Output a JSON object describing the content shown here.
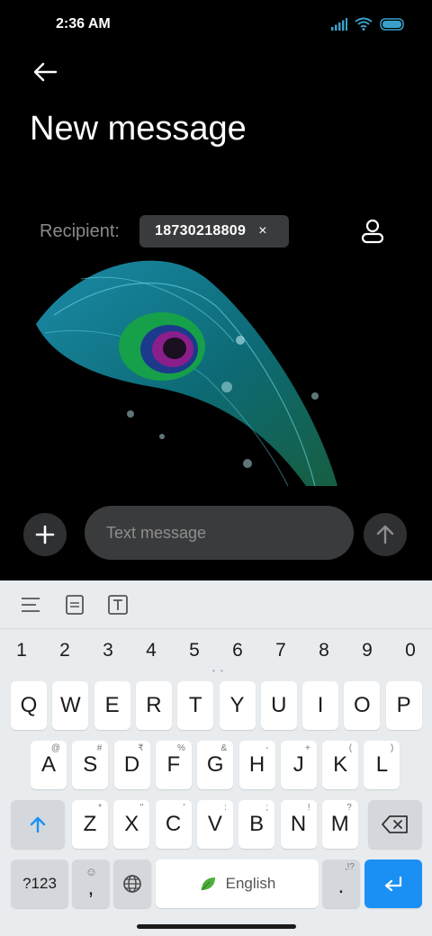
{
  "status_bar": {
    "time": "2:36 AM"
  },
  "header": {
    "title": "New message"
  },
  "recipient": {
    "label": "Recipient:",
    "chip_number": "18730218809",
    "chip_remove": "×"
  },
  "composer": {
    "placeholder": "Text message"
  },
  "keyboard": {
    "number_row": [
      "1",
      "2",
      "3",
      "4",
      "5",
      "6",
      "7",
      "8",
      "9",
      "0"
    ],
    "row1": [
      "Q",
      "W",
      "E",
      "R",
      "T",
      "Y",
      "U",
      "I",
      "O",
      "P"
    ],
    "row2": [
      {
        "key": "A",
        "hint": "@"
      },
      {
        "key": "S",
        "hint": "#"
      },
      {
        "key": "D",
        "hint": "₹"
      },
      {
        "key": "F",
        "hint": "%"
      },
      {
        "key": "G",
        "hint": "&"
      },
      {
        "key": "H",
        "hint": "-"
      },
      {
        "key": "J",
        "hint": "+"
      },
      {
        "key": "K",
        "hint": "("
      },
      {
        "key": "L",
        "hint": ")"
      }
    ],
    "row3": [
      {
        "key": "Z",
        "hint": "*"
      },
      {
        "key": "X",
        "hint": "\""
      },
      {
        "key": "C",
        "hint": "'"
      },
      {
        "key": "V",
        "hint": ":"
      },
      {
        "key": "B",
        "hint": ";"
      },
      {
        "key": "N",
        "hint": "!"
      },
      {
        "key": "M",
        "hint": "?"
      }
    ],
    "symbols_key": "?123",
    "comma_key": ",",
    "space_label": "English",
    "period_key": ".",
    "period_hint": ",!?"
  },
  "colors": {
    "enter_key": "#1a90f5",
    "background": "#000000",
    "keyboard_bg": "#e9ecef"
  }
}
